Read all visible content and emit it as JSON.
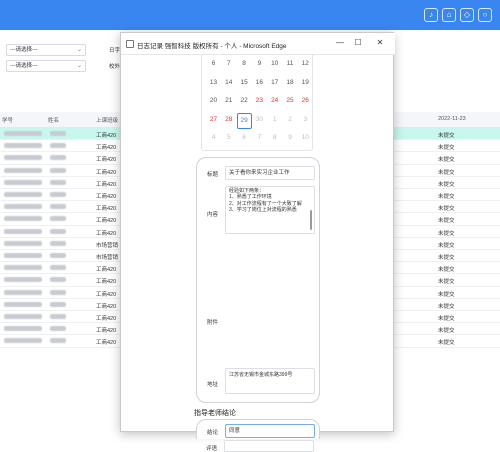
{
  "header": {
    "icons": [
      "bell-icon",
      "home-icon",
      "shield-icon",
      "user-icon"
    ]
  },
  "filters": {
    "select1": "---请选择---",
    "select2": "---请选择---",
    "label1": "日字",
    "label2": "校外"
  },
  "table": {
    "headers": [
      "学号",
      "姓名",
      "上课班级",
      "2022-11-23"
    ],
    "rows": [
      {
        "class": "工商420",
        "status": "未提交",
        "highlight": true
      },
      {
        "class": "工商420",
        "status": "未提交"
      },
      {
        "class": "工商420",
        "status": "未提交"
      },
      {
        "class": "工商420",
        "status": "未提交"
      },
      {
        "class": "工商420",
        "status": "未提交"
      },
      {
        "class": "工商420",
        "status": "未提交"
      },
      {
        "class": "工商420",
        "status": "未提交"
      },
      {
        "class": "工商420",
        "status": "未提交"
      },
      {
        "class": "工商420",
        "status": "未提交"
      },
      {
        "class": "市场营销",
        "status": "未提交"
      },
      {
        "class": "市场营销",
        "status": "未提交"
      },
      {
        "class": "工商420",
        "status": "未提交"
      },
      {
        "class": "工商420",
        "status": "未提交"
      },
      {
        "class": "工商420",
        "status": "未提交"
      },
      {
        "class": "工商420",
        "status": "未提交"
      },
      {
        "class": "工商420",
        "status": "未提交"
      },
      {
        "class": "工商420",
        "status": "未提交"
      },
      {
        "class": "工商420",
        "status": "未提交"
      }
    ]
  },
  "window": {
    "title": "日志记录 强智科技 版权所有 - 个人 - Microsoft Edge",
    "minimize": "—",
    "maximize": "☐",
    "close": "✕"
  },
  "calendar": {
    "rows": [
      [
        "6",
        "7",
        "8",
        "9",
        "10",
        "11",
        "12"
      ],
      [
        "13",
        "14",
        "15",
        "16",
        "17",
        "18",
        "19"
      ],
      [
        "20",
        "21",
        "22",
        "23",
        "24",
        "25",
        "26"
      ],
      [
        "27",
        "28",
        "29",
        "30",
        "1",
        "2",
        "3"
      ],
      [
        "4",
        "5",
        "6",
        "7",
        "8",
        "9",
        "10"
      ]
    ],
    "selected": "29"
  },
  "form": {
    "title_label": "标题",
    "title_value": "关于看你来实习企业工作",
    "content_label": "内容",
    "content_value": "经验如下两条：\n1、熟悉了工作环境\n2、对工作流程有了一个大致了解\n3、学习了岗位上对流程的熟悉",
    "attachment_label": "附件",
    "address_label": "地址",
    "address_value": "江苏省无锡市金城东路399号"
  },
  "teacher_section": {
    "heading": "指导老师结论",
    "conclusion_label": "结论",
    "conclusion_value": "同意",
    "comment_label": "评语"
  }
}
